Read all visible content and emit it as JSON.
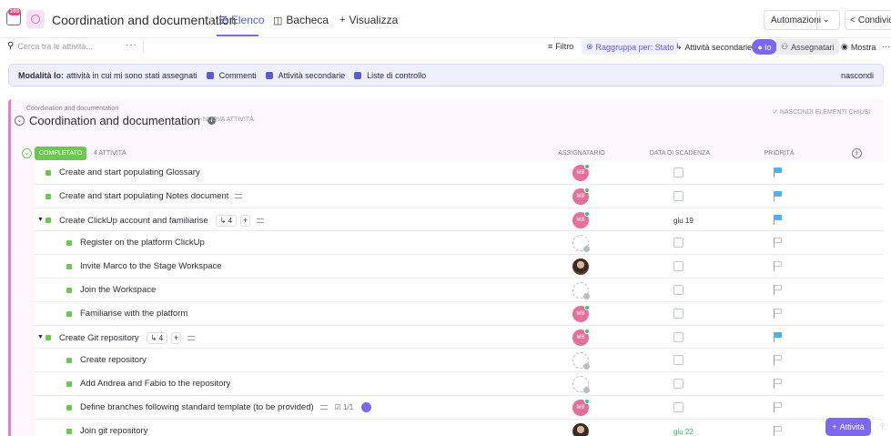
{
  "header": {
    "inbox_badge": "103",
    "title": "Coordination and documentation",
    "tabs": [
      {
        "label": "Elenco",
        "active": true
      },
      {
        "label": "Bacheca",
        "active": false
      },
      {
        "label": "Visualizza",
        "active": false
      }
    ],
    "automations_label": "Automazioni",
    "share_label": "Condividi"
  },
  "toolbar": {
    "search_placeholder": "Cerca tra le attività...",
    "filter_label": "Filtro",
    "group_label": "Raggruppa per: Stato",
    "subtasks_label": "Attività secondarie",
    "me_label": "Io",
    "assignees_label": "Assegnatari",
    "show_label": "Mostra"
  },
  "banner": {
    "strong": "Modalità Io:",
    "text": "attività in cui mi sono stati assegnati",
    "chips": [
      "Commenti",
      "Attività secondarie",
      "Liste di controllo"
    ],
    "hide_label": "nascondi"
  },
  "list": {
    "breadcrumb": "Coordination and documentation",
    "title": "Coordination and documentation",
    "new_task_label": "+ NUOVA ATTIVITÀ",
    "hide_closed_label": "NASCONDI ELEMENTI CHIUSI",
    "status": {
      "label": "COMPLETATO",
      "count_label": "4 ATTIVITÀ",
      "color": "#6bc950"
    },
    "columns": {
      "assignee": "ASSIGNATARIO",
      "due": "DATA DI SCADENZA",
      "priority": "PRIORITÀ"
    }
  },
  "tasks": [
    {
      "name": "Create and start populating Glossary",
      "level": 0,
      "expand": false,
      "desc": false,
      "subtasks": null,
      "check": null,
      "assignee": "MB",
      "assignee_type": "initials",
      "due": null,
      "priority": "blue"
    },
    {
      "name": "Create and start populating Notes document",
      "level": 0,
      "expand": false,
      "desc": true,
      "subtasks": null,
      "check": null,
      "assignee": "MB",
      "assignee_type": "initials",
      "due": null,
      "priority": "blue"
    },
    {
      "name": "Create ClickUp account and familiarise",
      "level": 0,
      "expand": true,
      "desc": true,
      "subtasks": "4",
      "check": null,
      "assignee": "MB",
      "assignee_type": "initials",
      "due": "giu 19",
      "due_color": "#292d34",
      "priority": "blue"
    },
    {
      "name": "Register on the platform ClickUp",
      "level": 1,
      "expand": false,
      "desc": false,
      "subtasks": null,
      "check": null,
      "assignee": null,
      "assignee_type": "empty",
      "due": null,
      "priority": "none"
    },
    {
      "name": "Invite Marco to the Stage Workspace",
      "level": 1,
      "expand": false,
      "desc": false,
      "subtasks": null,
      "check": null,
      "assignee": null,
      "assignee_type": "photo",
      "due": null,
      "priority": "none"
    },
    {
      "name": "Join the Workspace",
      "level": 1,
      "expand": false,
      "desc": false,
      "subtasks": null,
      "check": null,
      "assignee": null,
      "assignee_type": "empty",
      "due": null,
      "priority": "none"
    },
    {
      "name": "Familiarise with the platform",
      "level": 1,
      "expand": false,
      "desc": false,
      "subtasks": null,
      "check": null,
      "assignee": "MB",
      "assignee_type": "initials",
      "due": null,
      "priority": "none"
    },
    {
      "name": "Create Git repository",
      "level": 0,
      "expand": true,
      "desc": true,
      "subtasks": "4",
      "check": null,
      "assignee": "MB",
      "assignee_type": "initials",
      "due": null,
      "priority": "blue"
    },
    {
      "name": "Create repository",
      "level": 1,
      "expand": false,
      "desc": false,
      "subtasks": null,
      "check": null,
      "assignee": null,
      "assignee_type": "empty",
      "due": null,
      "priority": "none"
    },
    {
      "name": "Add Andrea and Fabio to the repository",
      "level": 1,
      "expand": false,
      "desc": false,
      "subtasks": null,
      "check": null,
      "assignee": null,
      "assignee_type": "empty",
      "due": null,
      "priority": "none"
    },
    {
      "name": "Define branches following standard template (to be provided)",
      "level": 1,
      "expand": false,
      "desc": true,
      "subtasks": null,
      "check": "1/1",
      "assignee": "MB",
      "assignee_type": "initials",
      "due": null,
      "priority": "none"
    },
    {
      "name": "Join git repository",
      "level": 1,
      "expand": false,
      "desc": false,
      "subtasks": null,
      "check": null,
      "assignee": null,
      "assignee_type": "photo",
      "due": "giu 22",
      "due_color": "#2fb55d",
      "priority": "none"
    }
  ],
  "fab_label": "Attività",
  "colors": {
    "accent": "#7b68ee",
    "list_accent": "#e57fd6",
    "done": "#6bc950",
    "flag_blue": "#4fb0f7",
    "flag_none": "#c3c6cc"
  }
}
